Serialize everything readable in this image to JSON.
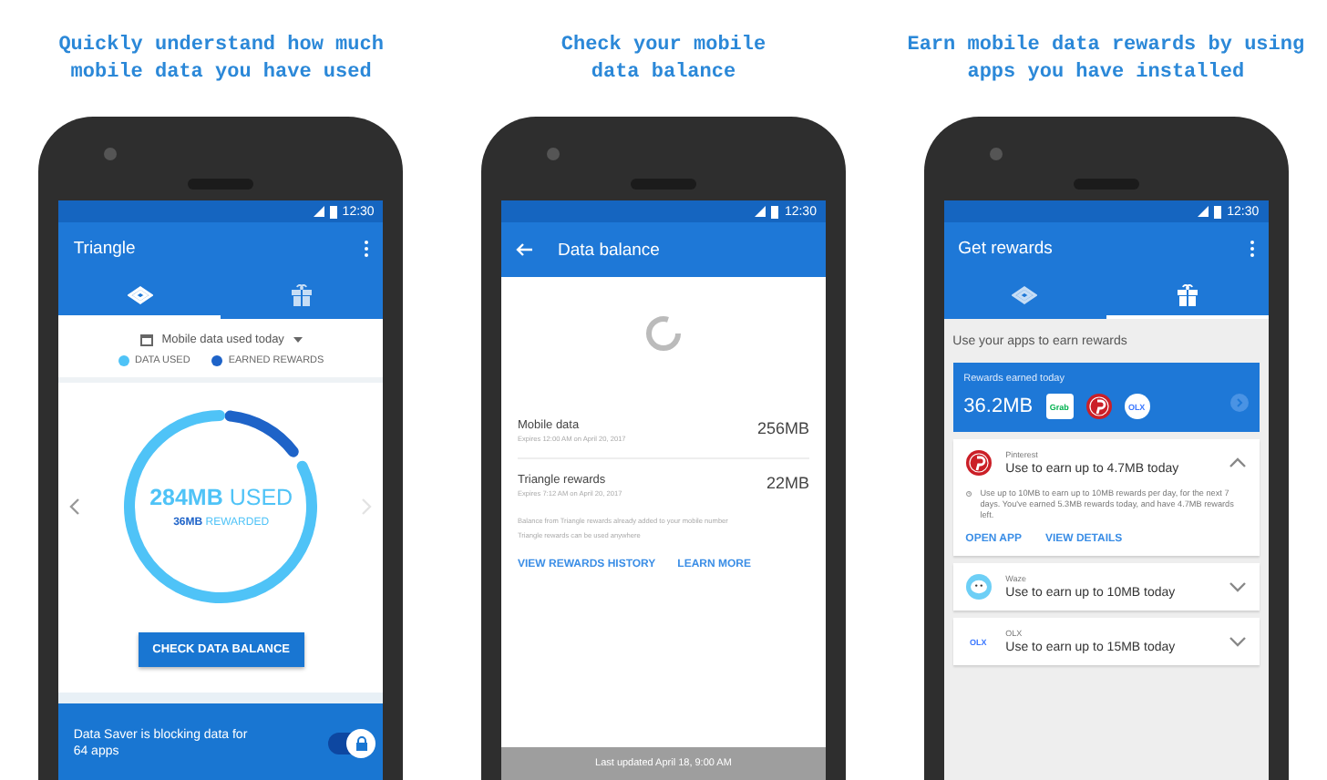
{
  "panels": [
    {
      "kind": "usage",
      "caption": [
        "Quickly understand how much",
        "mobile data you have used"
      ],
      "status_time": "12:30",
      "title": "Triangle",
      "tabs": [
        {
          "kind": "network",
          "selected": true
        },
        {
          "kind": "gift",
          "selected": false
        }
      ],
      "period": "Mobile data used today",
      "legend": [
        {
          "label": "DATA USED",
          "color": "#4fc3f7"
        },
        {
          "label": "EARNED REWARDS",
          "color": "#1e63c8"
        }
      ],
      "used": "**284MB** USED",
      "rewarded": "**36MB** REWARDED",
      "button": "CHECK DATA BALANCE",
      "banner": "Data Saver is blocking data for 64 apps",
      "data_saver_on": true
    },
    {
      "kind": "balance",
      "caption": [
        "Check your mobile",
        "data balance"
      ],
      "status_time": "12:30",
      "title": "Data balance",
      "items": [
        {
          "name": "Mobile data",
          "expiry": "Expires 12:00 AM on April 20, 2017",
          "amount": "256MB"
        },
        {
          "name": "Triangle rewards",
          "expiry": "Expires 7:12 AM on April 20, 2017",
          "amount": "22MB"
        }
      ],
      "notes": [
        "Balance from Triangle rewards already added to your mobile number",
        "Triangle rewards can be used anywhere"
      ],
      "links": [
        "VIEW REWARDS HISTORY",
        "LEARN MORE"
      ],
      "footer": "Last updated April 18, 9:00 AM"
    },
    {
      "kind": "rewards",
      "caption": [
        "Earn mobile data rewards by using",
        "apps you have installed"
      ],
      "status_time": "12:30",
      "title": "Get rewards",
      "tabs": [
        {
          "kind": "network",
          "selected": false
        },
        {
          "kind": "gift",
          "selected": true
        }
      ],
      "heading": "Use your apps to earn rewards",
      "earned_label": "Rewards earned today",
      "earned": "36.2MB",
      "logos": [
        {
          "kind": "grab",
          "text": "Grab"
        },
        {
          "kind": "pinterest"
        },
        {
          "kind": "olx",
          "text": "OLX"
        }
      ],
      "apps": [
        {
          "kind": "pinterest",
          "name": "Pinterest",
          "offer": "Use to earn up to 4.7MB today",
          "expanded": true,
          "detail": "Use up to 10MB to earn up to 10MB rewards per day, for the next 7 days. You've earned 5.3MB rewards today, and have 4.7MB rewards left.",
          "actions": [
            "OPEN APP",
            "VIEW DETAILS"
          ]
        },
        {
          "kind": "waze",
          "name": "Waze",
          "offer": "Use to earn up to 10MB today",
          "expanded": false
        },
        {
          "kind": "olx",
          "logo_text": "OLX",
          "name": "OLX",
          "offer": "Use to earn up to 15MB today",
          "expanded": false
        }
      ]
    }
  ]
}
